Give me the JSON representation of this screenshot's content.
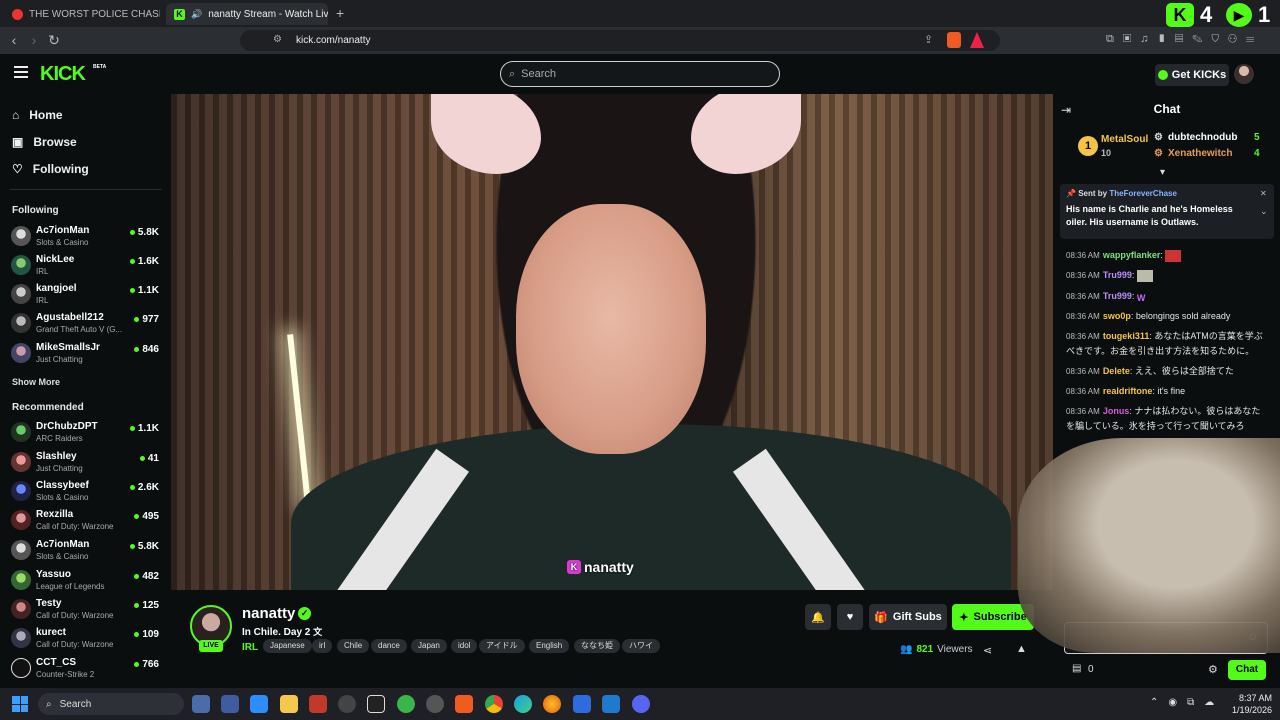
{
  "browser": {
    "tabs": [
      {
        "label": "THE WORST POLICE CHASE I'VE EVER"
      },
      {
        "label": "nanatty Stream - Watch Live o"
      }
    ],
    "url": "kick.com/nanatty"
  },
  "header": {
    "logo": "KICK",
    "beta": "BETA",
    "search_placeholder": "Search",
    "get_kicks": "Get KICKs"
  },
  "sidebar": {
    "nav": [
      {
        "label": "Home"
      },
      {
        "label": "Browse"
      },
      {
        "label": "Following"
      }
    ],
    "following_title": "Following",
    "following": [
      {
        "name": "Ac7ionMan",
        "category": "Slots & Casino",
        "viewers": "5.8K"
      },
      {
        "name": "NickLee",
        "category": "IRL",
        "viewers": "1.6K"
      },
      {
        "name": "kangjoel",
        "category": "IRL",
        "viewers": "1.1K"
      },
      {
        "name": "Agustabell212",
        "category": "Grand Theft Auto V (G...",
        "viewers": "977"
      },
      {
        "name": "MikeSmallsJr",
        "category": "Just Chatting",
        "viewers": "846"
      }
    ],
    "show_more": "Show More",
    "recommended_title": "Recommended",
    "recommended": [
      {
        "name": "DrChubzDPT",
        "category": "ARC Raiders",
        "viewers": "1.1K"
      },
      {
        "name": "Slashley",
        "category": "Just Chatting",
        "viewers": "41"
      },
      {
        "name": "Classybeef",
        "category": "Slots & Casino",
        "viewers": "2.6K"
      },
      {
        "name": "Rexzilla",
        "category": "Call of Duty: Warzone",
        "viewers": "495"
      },
      {
        "name": "Ac7ionMan",
        "category": "Slots & Casino",
        "viewers": "5.8K"
      },
      {
        "name": "Yassuo",
        "category": "League of Legends",
        "viewers": "482"
      },
      {
        "name": "Testy",
        "category": "Call of Duty: Warzone",
        "viewers": "125"
      },
      {
        "name": "kurect",
        "category": "Call of Duty: Warzone",
        "viewers": "109"
      },
      {
        "name": "CCT_CS",
        "category": "Counter-Strike 2",
        "viewers": "766"
      }
    ]
  },
  "video": {
    "watermark": "nanatty"
  },
  "stream": {
    "streamer": "nanatty",
    "live": "LIVE",
    "title": "In Chile. Day 2",
    "category": "IRL",
    "tags": [
      "Japanese",
      "irl",
      "Chile",
      "dance",
      "Japan",
      "idol",
      "アイドル",
      "English",
      "ななち姫",
      "ハワイ"
    ],
    "gift_subs": "Gift Subs",
    "subscribe": "Subscribe",
    "viewers_count": "821",
    "viewers_label": "Viewers"
  },
  "chat": {
    "title": "Chat",
    "top_gifters": [
      {
        "rank": "1",
        "name": "MetalSoul",
        "count": "10"
      },
      {
        "name": "dubtechnodub",
        "count": "5"
      },
      {
        "name": "Xenathewitch",
        "count": "4"
      }
    ],
    "pinned": {
      "sent_by": "Sent by",
      "user": "TheForeverChase",
      "text": "His name is Charlie and he's Homeless oiler. His username is Outlaws."
    },
    "messages": [
      {
        "time": "08:36 AM",
        "user": "wappyflanker",
        "text": ""
      },
      {
        "time": "08:36 AM",
        "user": "Tru999",
        "text": ""
      },
      {
        "time": "08:36 AM",
        "user": "Tru999",
        "text": ""
      },
      {
        "time": "08:36 AM",
        "user": "swo0p",
        "text": "belongings sold already"
      },
      {
        "time": "08:36 AM",
        "user": "tougeki311",
        "text": "あなたはATMの言葉を学ぶべきです。お金を引き出す方法を知るために。"
      },
      {
        "time": "08:36 AM",
        "user": "Delete",
        "text": "ええ、彼らは全部捨てた"
      },
      {
        "time": "08:36 AM",
        "user": "realdriftone",
        "text": "it's fine"
      },
      {
        "time": "08:36 AM",
        "user": "Jonus",
        "text": "ナナは払わない。彼らはあなたを騙している。氷を持って行って聞いてみろ"
      }
    ],
    "points": "0",
    "send": "Chat"
  },
  "taskbar": {
    "search": "Search",
    "time": "8:37 AM",
    "date": "1/19/2026"
  },
  "colors": {
    "accent": "#53fc18",
    "bg": "#0b0e0f"
  }
}
